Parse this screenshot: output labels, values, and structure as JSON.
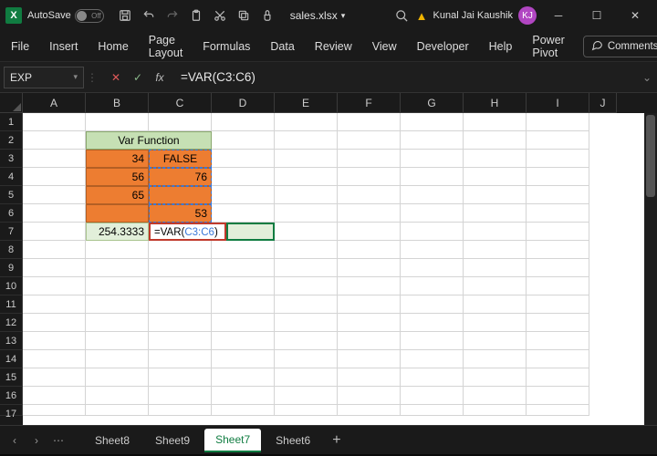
{
  "titlebar": {
    "autosave_label": "AutoSave",
    "autosave_state": "Off",
    "filename": "sales.xlsx",
    "user_name": "Kunal Jai Kaushik",
    "user_initials": "KJ"
  },
  "ribbon": {
    "tabs": [
      "File",
      "Insert",
      "Home",
      "Page Layout",
      "Formulas",
      "Data",
      "Review",
      "View",
      "Developer",
      "Help",
      "Power Pivot"
    ],
    "comments_label": "Comments"
  },
  "formula_bar": {
    "namebox": "EXP",
    "formula": "=VAR(C3:C6)"
  },
  "grid": {
    "columns": [
      "A",
      "B",
      "C",
      "D",
      "E",
      "F",
      "G",
      "H",
      "I",
      "J"
    ],
    "row_count": 17,
    "header_merged": "Var Function",
    "b3": "34",
    "c3": "FALSE",
    "b4": "56",
    "c4": "76",
    "b5": "65",
    "c5": "",
    "b6": "",
    "c6": "53",
    "b7": "254.3333",
    "c7_prefix": "=VAR(",
    "c7_ref": "C3:C6",
    "c7_suffix": ")"
  },
  "sheets": {
    "nav_left": "‹",
    "nav_right": "›",
    "tabs": [
      "Sheet8",
      "Sheet9",
      "Sheet7",
      "Sheet6"
    ],
    "active": "Sheet7",
    "add": "+"
  }
}
